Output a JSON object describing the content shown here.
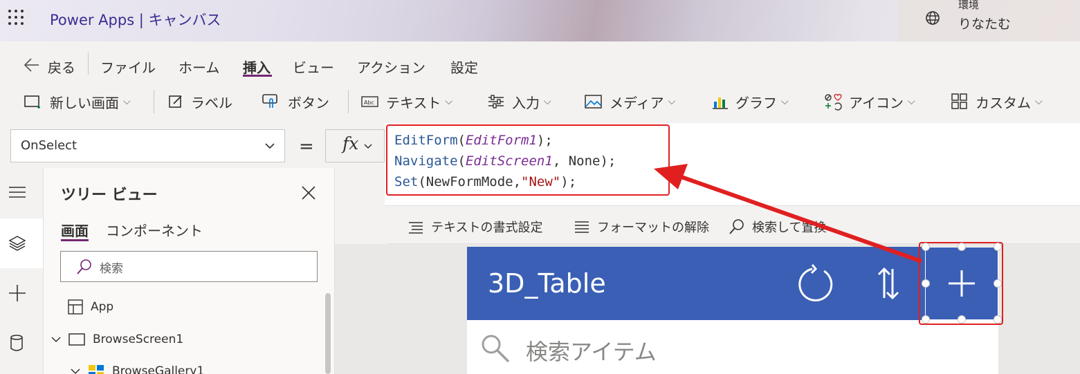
{
  "header": {
    "app_title": "Power Apps  |  キャンバス",
    "env_label": "環境",
    "env_name": "りなたむ"
  },
  "menu": {
    "back": "戻る",
    "items": [
      "ファイル",
      "ホーム",
      "挿入",
      "ビュー",
      "アクション",
      "設定"
    ],
    "active": "挿入"
  },
  "toolbar": {
    "new_screen": "新しい画面",
    "label": "ラベル",
    "button": "ボタン",
    "text": "テキスト",
    "input": "入力",
    "media": "メディア",
    "chart": "グラフ",
    "icon": "アイコン",
    "custom": "カスタム"
  },
  "formula": {
    "property": "OnSelect",
    "equals": "=",
    "fx": "fx",
    "line1_fn": "EditForm",
    "line1_arg": "EditForm1",
    "line1_end": ");",
    "line2_fn": "Navigate",
    "line2_arg": "EditScreen1",
    "line2_rest": ", None);",
    "line3_fn": "Set",
    "line3_mid": "(NewFormMode,",
    "line3_str": "\"New\"",
    "line3_end": ");"
  },
  "format_bar": {
    "format_text": "テキストの書式設定",
    "remove_format": "フォーマットの解除",
    "find_replace": "検索して置換"
  },
  "tree": {
    "title": "ツリー ビュー",
    "tab_screens": "画面",
    "tab_components": "コンポーネント",
    "search_placeholder": "検索",
    "items": [
      "App",
      "BrowseScreen1",
      "BrowseGallery1"
    ]
  },
  "canvas": {
    "app_name": "3D_Table",
    "search_placeholder": "検索アイテム"
  },
  "colors": {
    "accent": "#742774",
    "title": "#3b2d91",
    "app_header": "#3a5fb5",
    "highlight": "#e02020"
  }
}
